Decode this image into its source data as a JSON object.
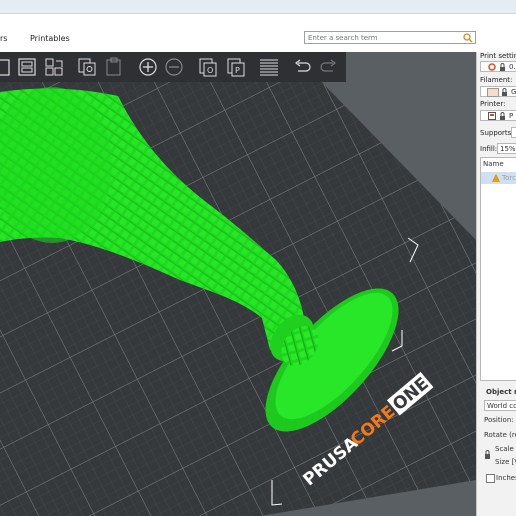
{
  "menu": {
    "items": [
      {
        "label": "rs"
      },
      {
        "label": "Printables"
      }
    ]
  },
  "search": {
    "placeholder": "Enter a search term"
  },
  "viewport": {
    "bed_brand": "PRUSA",
    "bed_model_a": "CORE",
    "bed_model_b": "ONE",
    "object_color": "#22e222",
    "bed_color": "#3a3d40",
    "accent": "#f27a1a"
  },
  "toolbar": {
    "icons": [
      "add-icon",
      "delete-icon",
      "arrange-icon",
      "copy-icon",
      "paste-icon",
      "add-instance-icon",
      "remove-instance-icon",
      "split-objects-icon",
      "split-parts-icon",
      "layers-editing-icon",
      "undo-icon",
      "redo-icon"
    ]
  },
  "right_panel": {
    "print_settings_label": "Print setting",
    "print_settings_value": "0.",
    "filament_label": "Filament:",
    "filament_value": "G",
    "printer_label": "Printer:",
    "printer_value": "P",
    "supports_label": "Supports:",
    "infill_label": "Infill:",
    "infill_value": "15%",
    "list_header": "Name",
    "list_item": "Torc",
    "manip_title": "Object m",
    "coords_value": "World co",
    "position_label": "Position:",
    "rotate_label": "Rotate (rel",
    "scale_label": "Scale f",
    "size_label": "Size [V",
    "inches_label": "Inches"
  }
}
